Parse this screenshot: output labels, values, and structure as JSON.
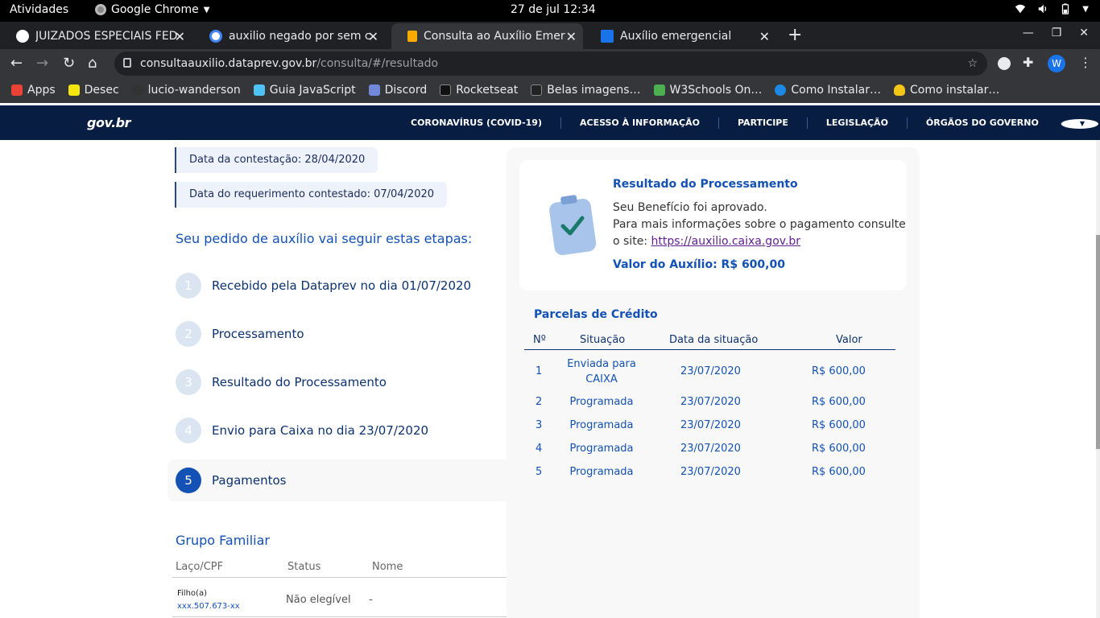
{
  "os_bar": {
    "activities": "Atividades",
    "app_name": "Google Chrome",
    "clock": "27 de jul  12:34"
  },
  "tabs": [
    {
      "title": "JUIZADOS ESPECIAIS FEDE",
      "favicon_color": "#ffffff"
    },
    {
      "title": "auxilio negado por sem ca",
      "favicon_color": "#4285f4"
    },
    {
      "title": "Consulta ao Auxílio Emerg",
      "favicon_color": "#f9ab00"
    },
    {
      "title": "Auxílio emergencial",
      "favicon_color": "#1a73e8"
    }
  ],
  "omnibox": {
    "host": "consultaauxilio.dataprev.gov.br",
    "path": "/consulta/#/resultado"
  },
  "profile_initial": "W",
  "bookmarks": [
    {
      "label": "Apps",
      "color": "#ea4335"
    },
    {
      "label": "Desec",
      "color": "#f5e50a"
    },
    {
      "label": "lucio-wanderson",
      "color": "#333333"
    },
    {
      "label": "Guia JavaScript",
      "color": "#4fc3f7"
    },
    {
      "label": "Discord",
      "color": "#7289da"
    },
    {
      "label": "Rocketseat",
      "color": "#111111"
    },
    {
      "label": "Belas imagens…",
      "color": "#222222"
    },
    {
      "label": "W3Schools On…",
      "color": "#4caf50"
    },
    {
      "label": "Como Instalar…",
      "color": "#1e88e5"
    },
    {
      "label": "Como instalar…",
      "color": "#f5c518"
    }
  ],
  "gov_header": {
    "logo": "gov.br",
    "nav": [
      "CORONAVÍRUS (COVID-19)",
      "ACESSO À INFORMAÇÃO",
      "PARTICIPE",
      "LEGISLAÇÃO",
      "ÓRGÃOS DO GOVERNO"
    ]
  },
  "dates": {
    "contestacao": "Data da contestação: 28/04/2020",
    "requerimento": "Data do requerimento contestado: 07/04/2020"
  },
  "steps_title": "Seu pedido de auxílio vai seguir estas etapas:",
  "steps": [
    {
      "num": "1",
      "label": "Recebido pela Dataprev no dia 01/07/2020"
    },
    {
      "num": "2",
      "label": "Processamento"
    },
    {
      "num": "3",
      "label": "Resultado do Processamento"
    },
    {
      "num": "4",
      "label": "Envio para Caixa no dia 23/07/2020"
    },
    {
      "num": "5",
      "label": "Pagamentos"
    }
  ],
  "result": {
    "title": "Resultado do Processamento",
    "line1": "Seu Benefício foi aprovado.",
    "line2": "Para mais informações sobre o pagamento consulte",
    "line3_prefix": "o site: ",
    "link": "https://auxilio.caixa.gov.br",
    "value": "Valor do Auxílio: R$ 600,00"
  },
  "parcelas": {
    "title": "Parcelas de Crédito",
    "headers": [
      "Nº",
      "Situação",
      "Data da situação",
      "Valor"
    ],
    "rows": [
      {
        "n": "1",
        "situacao": "Enviada para CAIXA",
        "data": "23/07/2020",
        "valor": "R$ 600,00"
      },
      {
        "n": "2",
        "situacao": "Programada",
        "data": "23/07/2020",
        "valor": "R$ 600,00"
      },
      {
        "n": "3",
        "situacao": "Programada",
        "data": "23/07/2020",
        "valor": "R$ 600,00"
      },
      {
        "n": "4",
        "situacao": "Programada",
        "data": "23/07/2020",
        "valor": "R$ 600,00"
      },
      {
        "n": "5",
        "situacao": "Programada",
        "data": "23/07/2020",
        "valor": "R$ 600,00"
      }
    ]
  },
  "family": {
    "title": "Grupo Familiar",
    "headers": [
      "Laço/CPF",
      "Status",
      "Nome"
    ],
    "row": {
      "laco": "Filho(a)",
      "cpf": "xxx.507.673-xx",
      "status": "Não elegível",
      "nome": "-"
    }
  }
}
